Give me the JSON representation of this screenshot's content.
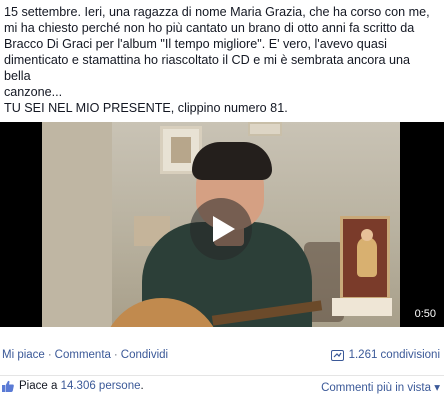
{
  "post": {
    "line1": "15 settembre. Ieri, una ragazza di nome Maria Grazia, che ha corso con me,",
    "line2": "mi ha chiesto perché non ho più cantato un brano di otto anni fa scritto da",
    "line3": "Bracco Di Graci per l'album \"Il tempo migliore\". E' vero, l'avevo quasi",
    "line4": "dimenticato e stamattina ho riascoltato il CD e mi è sembrata ancora una bella",
    "line5": "canzone...",
    "line6": "TU SEI NEL MIO PRESENTE, clippino numero 81."
  },
  "video": {
    "duration": "0:50",
    "play_icon": "play-icon"
  },
  "actions": {
    "like": "Mi piace",
    "separator": "·",
    "comment": "Commenta",
    "share": "Condividi",
    "shares_count": "1.261 condivisioni",
    "share_icon": "share-icon"
  },
  "likes": {
    "prefix": "Piace a",
    "count": "14.306 persone",
    "suffix": ".",
    "like_icon": "thumbs-up-icon",
    "comments_link": "Commenti più in vista",
    "comments_chevron": "▾"
  },
  "colors": {
    "link": "#3b5998",
    "text": "#141823"
  }
}
